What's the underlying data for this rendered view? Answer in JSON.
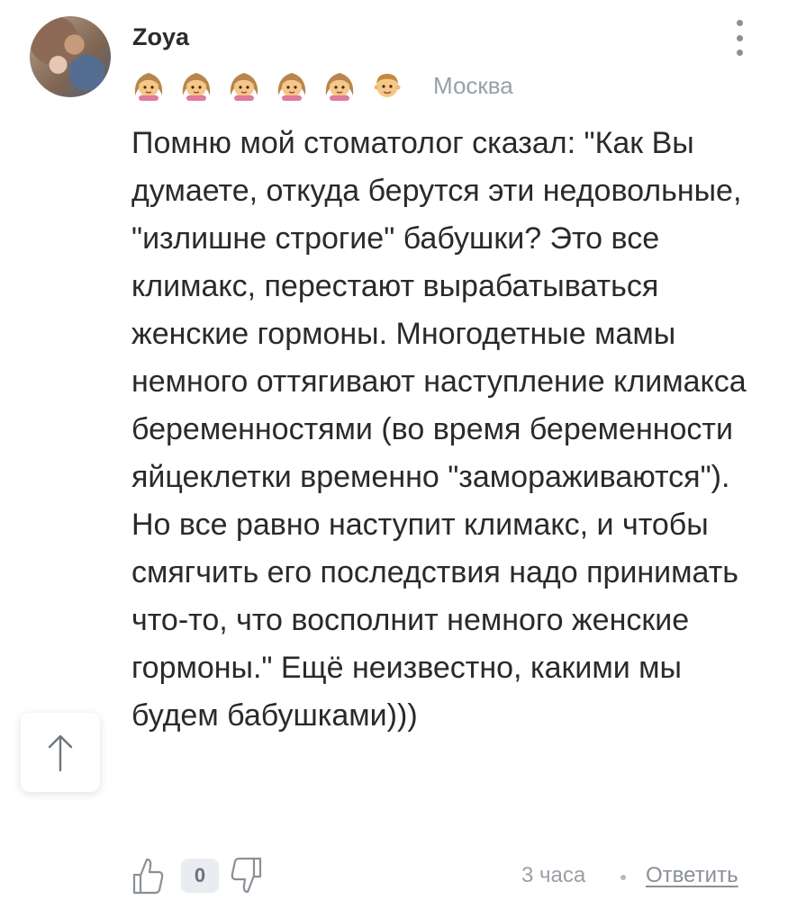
{
  "comment": {
    "author": "Zoya",
    "location": "Москва",
    "badges": [
      {
        "icon": "girl-emoji-icon"
      },
      {
        "icon": "girl-emoji-icon"
      },
      {
        "icon": "girl-emoji-icon"
      },
      {
        "icon": "girl-emoji-icon"
      },
      {
        "icon": "girl-emoji-icon"
      },
      {
        "icon": "boy-emoji-icon"
      }
    ],
    "text": "Помню мой стоматолог сказал: \"Как Вы думаете, откуда берутся эти недовольные, \"излишне строгие\" бабушки? Это все климакс, перестают вырабатываться женские гормоны. Многодетные мамы немного оттягивают наступление климакса беременностями (во время беременности яйцеклетки временно \"замораживаются\"). Но все равно наступит климакс, и чтобы смягчить его последствия надо принимать что-то, что восполнит немного женские гормоны.\" Ещё неизвестно, какими мы будем бабушками)))",
    "votes": "0",
    "time": "3 часа",
    "reply_label": "Ответить"
  },
  "colors": {
    "text": "#2a2a2a",
    "muted": "#9aa0a6",
    "vote_bg": "#e9ecf0",
    "icon": "#8a9097"
  },
  "icons": {
    "menu": "more-vertical-icon",
    "scroll": "arrow-up-icon",
    "like": "thumbs-up-icon",
    "dislike": "thumbs-down-icon"
  }
}
